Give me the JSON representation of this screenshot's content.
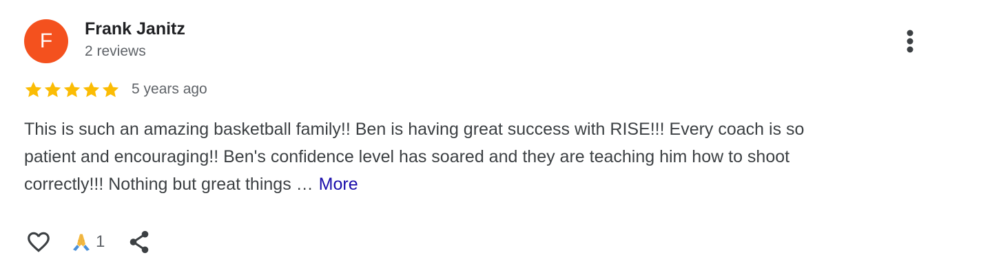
{
  "review": {
    "author": {
      "initial": "F",
      "name": "Frank Janitz",
      "review_count": "2 reviews",
      "avatar_color": "#f4511e"
    },
    "rating": 5,
    "rating_max": 5,
    "star_color": "#fbbc04",
    "date": "5 years ago",
    "text_lines": [
      "This is such an amazing basketball family!! Ben is having great success with RISE!!! Every coach is so",
      "patient and encouraging!! Ben's confidence level has soared and they are teaching him how to shoot",
      "correctly!!! Nothing but great things …"
    ],
    "more_label": "More",
    "more_color": "#1a0dab",
    "actions": {
      "like_icon": "heart-outline-icon",
      "reaction_icon": "folded-hands-icon",
      "reaction_count": "1",
      "share_icon": "share-icon"
    },
    "menu_icon": "more-vert-icon"
  }
}
